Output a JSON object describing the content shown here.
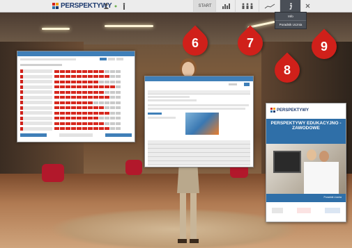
{
  "topbar": {
    "logo_text": "PERSPEKTYWY",
    "start_label": "START"
  },
  "dropdown": {
    "items": [
      "Info",
      "Poradnik Ucznia"
    ]
  },
  "markers": [
    "6",
    "7",
    "8",
    "9"
  ],
  "book": {
    "logo_text": "PERSPEKTYWY",
    "title": "PERSPEKTYWY EDUKACYJNO - ZAWODOWE",
    "tag": "Poradnik Ucznia"
  },
  "colors": {
    "accent_blue": "#3f7fb8",
    "marker_red": "#d0201a",
    "logo_navy": "#1d3a6e"
  },
  "icons": [
    "user-icon",
    "chart-icon",
    "people-icon",
    "trend-icon",
    "info-icon",
    "close-icon"
  ]
}
